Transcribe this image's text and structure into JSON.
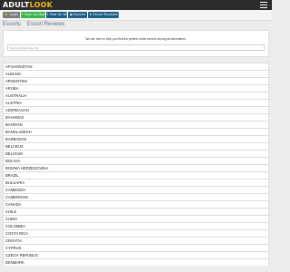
{
  "header": {
    "logo_part1": "ADULT",
    "logo_part2": "LOOK",
    "menu_icon": "hamburger-menu-icon"
  },
  "nav": {
    "buttons": [
      {
        "label": "🔒 Login",
        "icon": "lock-icon",
        "color": "#7b7b7b"
      },
      {
        "label": "✔ Sign Up Now",
        "icon": "check-icon",
        "color": "#3bb54a"
      },
      {
        "label": "+ Post An Ad",
        "icon": "plus-icon",
        "color": "#1d5e87"
      },
      {
        "label": "◉ Escorts",
        "icon": "escorts-icon",
        "color": "#1d5e87"
      },
      {
        "label": "★ Escort Reviews",
        "icon": "star-icon",
        "color": "#1d5e87"
      }
    ]
  },
  "subnav": {
    "items": [
      "Escorts",
      "Escort Reviews"
    ]
  },
  "panel": {
    "message": "We are here to help you find the perfect erotic service among all advertisers.",
    "search_placeholder": "Name/Ad/Number/ID"
  },
  "countries": [
    "AFGHANISTAN",
    "ALBANIA",
    "ARGENTINA",
    "ARUBA",
    "AUSTRALIA",
    "AUSTRIA",
    "AZERBAIJAN",
    "BAHAMAS",
    "BAHRAIN",
    "BANGLADESH",
    "BARBADOS",
    "BELARUS",
    "BELGIUM",
    "BOLIVIA",
    "BOSNIA HERZEGOVINA",
    "BRAZIL",
    "BULGARIA",
    "CAMBODIA",
    "CAMEROON",
    "CANADA",
    "CHILE",
    "CHINA",
    "COLOMBIA",
    "COSTA RICA",
    "CROATIA",
    "CYPRUS",
    "CZECH REPUBLIC",
    "DENMARK"
  ]
}
